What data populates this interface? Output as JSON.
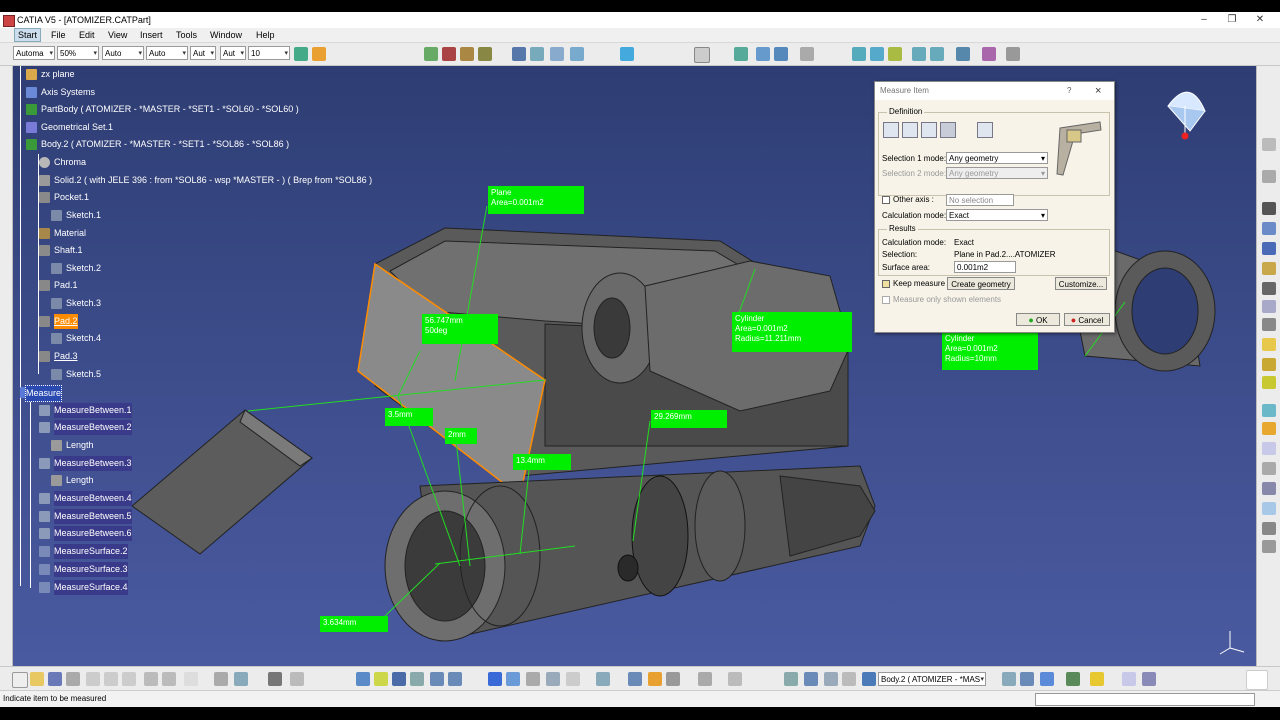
{
  "window": {
    "title": "CATIA V5 - [ATOMIZER.CATPart]"
  },
  "menu": [
    "Start",
    "File",
    "Edit",
    "View",
    "Insert",
    "Tools",
    "Window",
    "Help"
  ],
  "toolbar": {
    "combos": [
      "Automa",
      "50%",
      "Auto",
      "Auto",
      "Aut",
      "Aut",
      "10"
    ]
  },
  "tree": [
    {
      "label": "zx plane",
      "icon": "plane-icon"
    },
    {
      "label": "Axis Systems",
      "icon": "axis-system-icon"
    },
    {
      "label": "PartBody ( ATOMIZER - *MASTER - *SET1 - *SOL60 - *SOL60 )",
      "icon": "body-icon"
    },
    {
      "label": "Geometrical Set.1",
      "icon": "geometrical-set-icon"
    },
    {
      "label": "Body.2 ( ATOMIZER - *MASTER - *SET1 - *SOL86 - *SOL86 )",
      "icon": "body-icon"
    },
    {
      "label": "Chroma",
      "icon": "sphere-icon"
    },
    {
      "label": "Solid.2 (  with JELE 396 : from *SOL86 - wsp *MASTER -  ) ( Brep from *SOL86 )",
      "icon": "solid-icon"
    },
    {
      "label": "Pocket.1",
      "icon": "pocket-icon"
    },
    {
      "label": "Sketch.1",
      "icon": "sketch-icon"
    },
    {
      "label": "Material",
      "icon": "material-icon"
    },
    {
      "label": "Shaft.1",
      "icon": "shaft-icon"
    },
    {
      "label": "Sketch.2",
      "icon": "sketch-icon"
    },
    {
      "label": "Pad.1",
      "icon": "pad-icon"
    },
    {
      "label": "Sketch.3",
      "icon": "sketch-icon"
    },
    {
      "label": "Pad.2",
      "icon": "pad-icon"
    },
    {
      "label": "Sketch.4",
      "icon": "sketch-icon"
    },
    {
      "label": "Pad.3",
      "icon": "pad-icon"
    },
    {
      "label": "Sketch.5",
      "icon": "sketch-icon"
    },
    {
      "label": "Measure",
      "icon": "measure-icon"
    },
    {
      "label": "MeasureBetween.1",
      "icon": "measure-between-icon"
    },
    {
      "label": "MeasureBetween.2",
      "icon": "measure-between-icon"
    },
    {
      "label": "Length",
      "icon": "length-icon"
    },
    {
      "label": "MeasureBetween.3",
      "icon": "measure-between-icon"
    },
    {
      "label": "Length",
      "icon": "length-icon"
    },
    {
      "label": "MeasureBetween.4",
      "icon": "measure-between-icon"
    },
    {
      "label": "MeasureBetween.5",
      "icon": "measure-between-icon"
    },
    {
      "label": "MeasureBetween.6",
      "icon": "measure-between-icon"
    },
    {
      "label": "MeasureSurface.2",
      "icon": "measure-surface-icon"
    },
    {
      "label": "MeasureSurface.3",
      "icon": "measure-surface-icon"
    },
    {
      "label": "MeasureSurface.4",
      "icon": "measure-surface-icon"
    }
  ],
  "annotations": {
    "plane": [
      "Plane",
      "Area=0.001m2"
    ],
    "angle": [
      "56.747mm",
      "50deg"
    ],
    "cyl1": [
      "Cylinder",
      "Area=0.001m2",
      "Radius=11.211mm"
    ],
    "cyl2": [
      "Cylinder",
      "Area=0.001m2",
      "Radius=10mm"
    ],
    "d1": "3.5mm",
    "d2": "2mm",
    "d3": "13.4mm",
    "d4": "29.269mm",
    "d5": "3.634mm"
  },
  "dialog": {
    "title": "Measure Item",
    "help": "?",
    "close": "×",
    "definition_label": "Definition",
    "sel1_label": "Selection 1 mode:",
    "sel1_value": "Any geometry",
    "sel2_label": "Selection 2 mode:",
    "sel2_value": "Any geometry",
    "other_axis_label": "Other axis :",
    "other_axis_value": "No selection",
    "calc_mode_label": "Calculation mode:",
    "calc_mode_value": "Exact",
    "results_label": "Results",
    "res_calc_label": "Calculation mode:",
    "res_calc_value": "Exact",
    "res_sel_label": "Selection:",
    "res_sel_value": "Plane in Pad.2....ATOMIZER",
    "res_area_label": "Surface area:",
    "res_area_value": "0.001m2",
    "keep_measure": "Keep measure",
    "create_geometry": "Create geometry",
    "customize": "Customize...",
    "only_shown": "Measure only shown elements",
    "ok": "OK",
    "cancel": "Cancel"
  },
  "bottom_combo": "Body.2 ( ATOMIZER - *MAS",
  "status": {
    "text": "Indicate item to be measured"
  },
  "colors": {
    "accent_green": "#00ee00",
    "highlight_orange": "#ff8c00",
    "background_top": "#2e3d73"
  }
}
